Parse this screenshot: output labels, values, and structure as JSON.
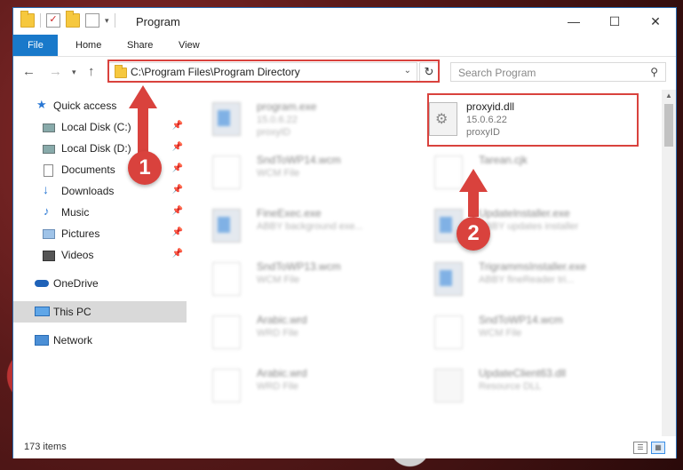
{
  "window": {
    "title": "Program"
  },
  "ribbon": {
    "tabs": [
      "File",
      "Home",
      "Share",
      "View"
    ]
  },
  "address": {
    "path": "C:\\Program Files\\Program Directory"
  },
  "search": {
    "placeholder": "Search Program"
  },
  "sidebar": {
    "items": [
      {
        "label": "Quick access",
        "icon": "star-icon"
      },
      {
        "label": "Local Disk (C:)",
        "icon": "drive-icon"
      },
      {
        "label": "Local Disk (D:)",
        "icon": "drive-icon"
      },
      {
        "label": "Documents",
        "icon": "documents-icon"
      },
      {
        "label": "Downloads",
        "icon": "download-icon"
      },
      {
        "label": "Music",
        "icon": "music-icon"
      },
      {
        "label": "Pictures",
        "icon": "pictures-icon"
      },
      {
        "label": "Videos",
        "icon": "videos-icon"
      },
      {
        "label": "OneDrive",
        "icon": "cloud-icon"
      },
      {
        "label": "This PC",
        "icon": "computer-icon"
      },
      {
        "label": "Network",
        "icon": "network-icon"
      }
    ]
  },
  "files": [
    {
      "name": "program.exe",
      "line2": "15.0.6.22",
      "line3": "proxyID",
      "icon": "exe"
    },
    {
      "name": "proxyid.dll",
      "line2": "15.0.6.22",
      "line3": "proxyID",
      "icon": "dll"
    },
    {
      "name": "SndToWP14.wcm",
      "line2": "WCM File",
      "line3": "",
      "icon": "doc"
    },
    {
      "name": "Tarean.cjk",
      "line2": "",
      "line3": "",
      "icon": "doc"
    },
    {
      "name": "FineExec.exe",
      "line2": "ABBY background exe...",
      "line3": "",
      "icon": "exe"
    },
    {
      "name": "UpdateInstaller.exe",
      "line2": "ABBY updates installer",
      "line3": "",
      "icon": "exe"
    },
    {
      "name": "SndToWP13.wcm",
      "line2": "WCM File",
      "line3": "",
      "icon": "doc"
    },
    {
      "name": "TrigrammsInstaller.exe",
      "line2": "ABBY fineReader tri...",
      "line3": "",
      "icon": "exe"
    },
    {
      "name": "Arabic.wrd",
      "line2": "WRD File",
      "line3": "",
      "icon": "doc"
    },
    {
      "name": "SndToWP14.wcm",
      "line2": "WCM File",
      "line3": "",
      "icon": "doc"
    },
    {
      "name": "Arabic.wrd",
      "line2": "WRD File",
      "line3": "",
      "icon": "doc"
    },
    {
      "name": "UpdateClient63.dll",
      "line2": "Resource DLL",
      "line3": "",
      "icon": "dll"
    }
  ],
  "status": {
    "count": "173 items"
  },
  "annotations": {
    "step1": "1",
    "step2": "2"
  },
  "colors": {
    "accent": "#1979ca",
    "highlight": "#d9423d"
  }
}
